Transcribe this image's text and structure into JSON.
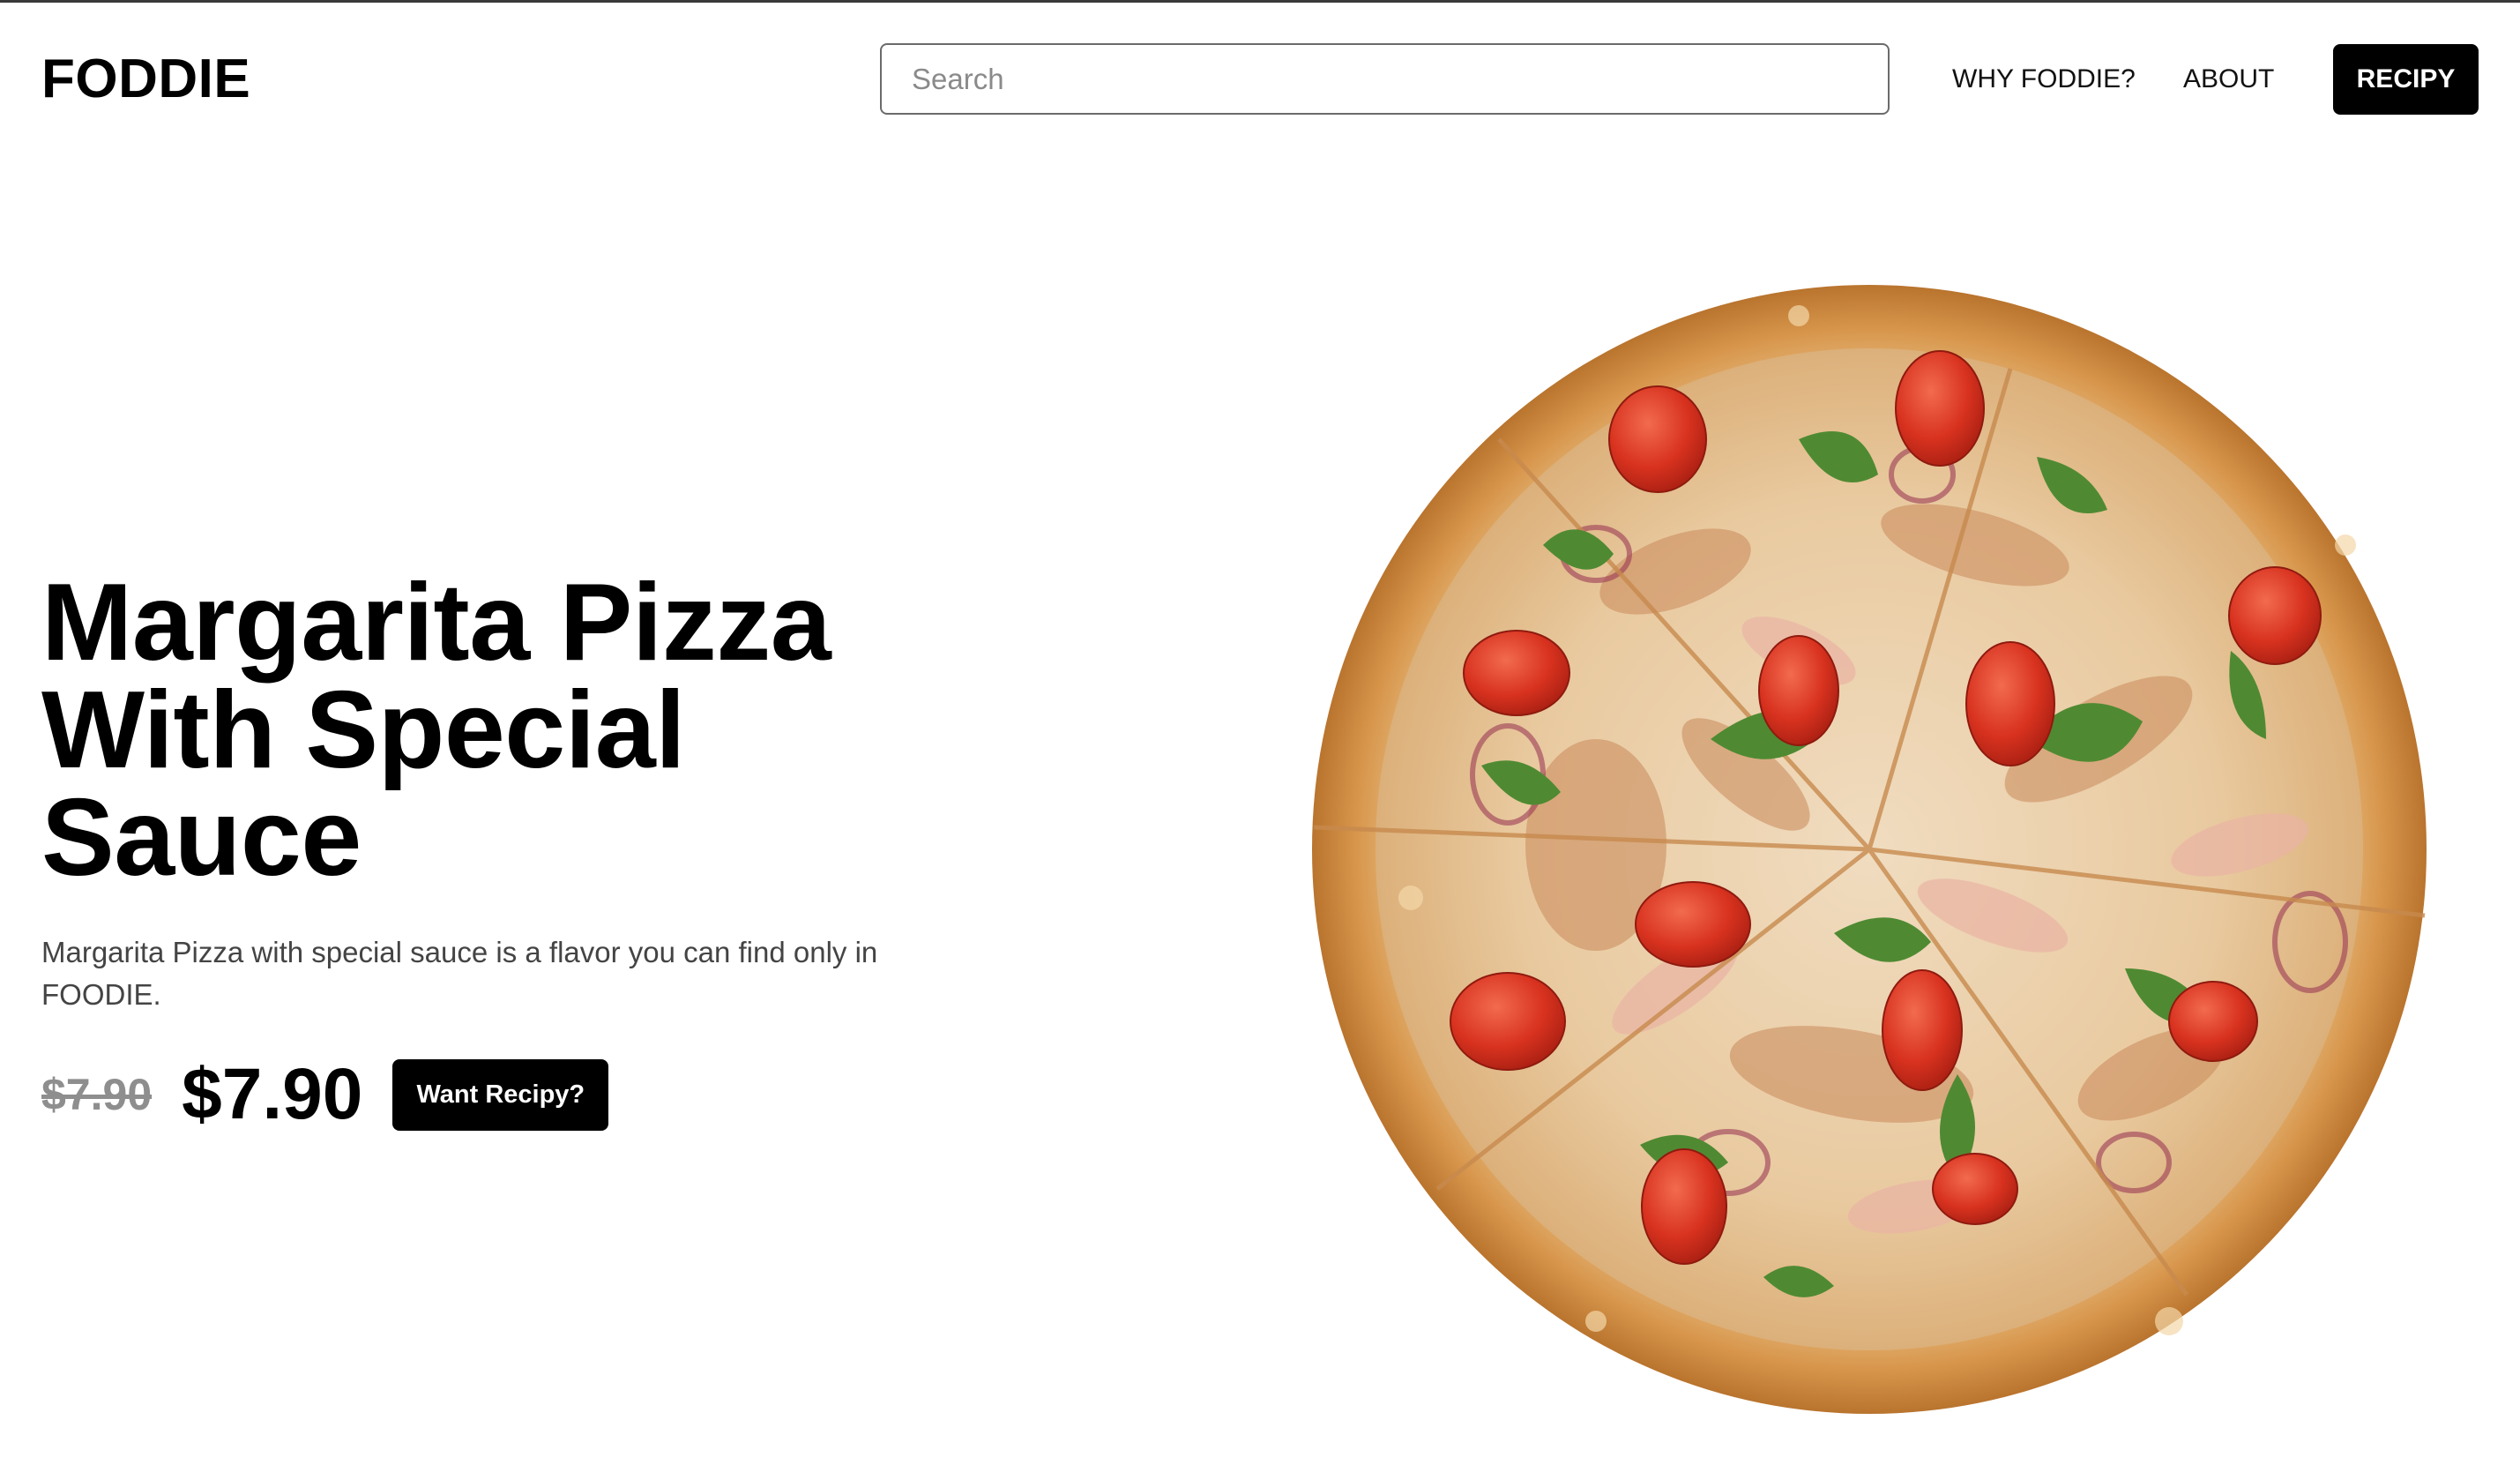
{
  "header": {
    "logo": "FODDIE",
    "search_placeholder": "Search",
    "nav": {
      "why": "WHY FODDIE?",
      "about": "ABOUT",
      "cta": "RECIPY"
    }
  },
  "hero": {
    "title": "Margarita Pizza With Special Sauce",
    "description": "Margarita Pizza with special sauce is a flavor you can find only in FOODIE.",
    "old_price": "$7.90",
    "price": "$7.90",
    "cta": "Want Recipy?"
  },
  "image": {
    "subject": "pizza-image"
  },
  "colors": {
    "primary": "#000000",
    "background": "#ffffff",
    "muted": "#8e8e8e",
    "body_text": "#444444",
    "crust": "#d89a52",
    "tomato": "#d8321f",
    "arugula": "#4f8a32"
  }
}
